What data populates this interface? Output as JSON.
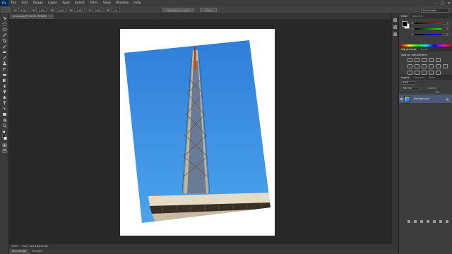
{
  "app": {
    "logo": "Ps"
  },
  "menu": [
    "File",
    "Edit",
    "Image",
    "Layer",
    "Type",
    "Select",
    "Filter",
    "View",
    "Window",
    "Help"
  ],
  "window_controls": [
    "–",
    "□",
    "✕"
  ],
  "options": {
    "fields": [
      {
        "label": "X:",
        "value": "0.00"
      },
      {
        "label": "Y:",
        "value": "1.00"
      },
      {
        "label": "W:",
        "value": "0.00"
      },
      {
        "label": "H:",
        "value": "0.00"
      },
      {
        "label": "L:",
        "value": "0.00"
      },
      {
        "label": "R:",
        "value": "1.0"
      }
    ],
    "button_1": "Straighten Layer",
    "button_2": "Clear",
    "workspace": "Essentials"
  },
  "document": {
    "tab_title": "photo.jpg @ 200% (RGB/8)",
    "tab_close": "×"
  },
  "status": {
    "zoom": "100%",
    "doc_info": "Doc: 421.4K/421.4K"
  },
  "bottom_tabs": [
    "Mini Bridge",
    "Timeline"
  ],
  "color_panel": {
    "tabs": [
      "Color",
      "Swatches"
    ],
    "channels": [
      {
        "label": "R",
        "value": "0"
      },
      {
        "label": "G",
        "value": "0"
      },
      {
        "label": "B",
        "value": "0"
      }
    ],
    "foreground": "#000000",
    "background": "#ffffff"
  },
  "adjustments_panel": {
    "tabs": [
      "Adjustments",
      "Styles"
    ],
    "title": "Add an adjustment"
  },
  "layers_panel": {
    "tabs": [
      "Layers",
      "Channels",
      "Paths"
    ],
    "kind_filter": "Kind",
    "blend_mode": "Normal",
    "opacity_label": "Opacity:",
    "fill_label": "Fill:",
    "layer_name": "Background"
  },
  "colors": {
    "accent": "#2f84d8",
    "sky": "#3a8fde",
    "selected_layer": "#4a5a78"
  }
}
